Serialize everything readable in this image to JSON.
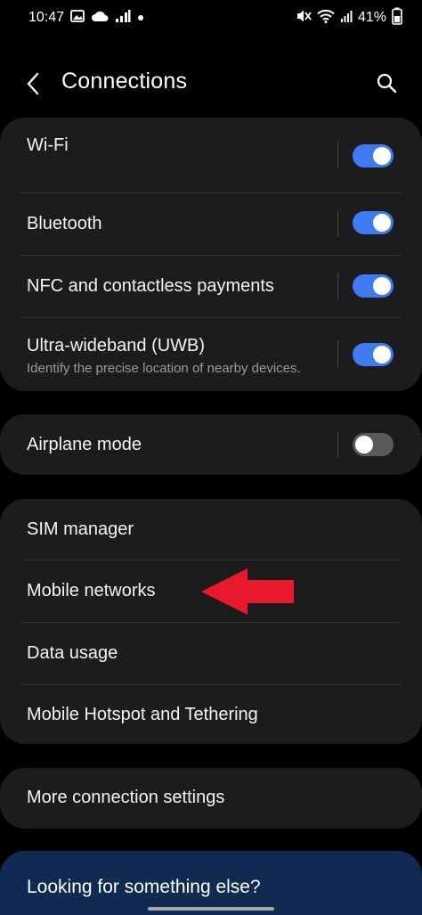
{
  "status_bar": {
    "time": "10:47",
    "battery": "41%",
    "left_icons": [
      "gallery-icon",
      "cloud-icon",
      "signal-icon",
      "dot-icon"
    ],
    "right_icons": [
      "mute-icon",
      "wifi-icon",
      "signal-icon",
      "battery-icon"
    ]
  },
  "header": {
    "title": "Connections",
    "back_icon": "back-arrow-icon",
    "search_icon": "search-icon"
  },
  "group1": {
    "items": [
      {
        "label": "Wi-Fi",
        "toggle": "on"
      },
      {
        "label": "Bluetooth",
        "toggle": "on"
      },
      {
        "label": "NFC and contactless payments",
        "toggle": "on"
      },
      {
        "label": "Ultra-wideband (UWB)",
        "subtitle": "Identify the precise location of nearby devices.",
        "toggle": "on"
      }
    ]
  },
  "group2": {
    "items": [
      {
        "label": "Airplane mode",
        "toggle": "off"
      }
    ]
  },
  "group3": {
    "items": [
      {
        "label": "SIM manager"
      },
      {
        "label": "Mobile networks"
      },
      {
        "label": "Data usage"
      },
      {
        "label": "Mobile Hotspot and Tethering"
      }
    ]
  },
  "group4": {
    "items": [
      {
        "label": "More connection settings"
      }
    ]
  },
  "help": {
    "title": "Looking for something else?"
  },
  "colors": {
    "background": "#000000",
    "card": "#1c1c1e",
    "toggle_on": "#3e7bf0",
    "toggle_off": "#5a5a5c",
    "arrow": "#e8192c",
    "help_card": "#102a52"
  }
}
